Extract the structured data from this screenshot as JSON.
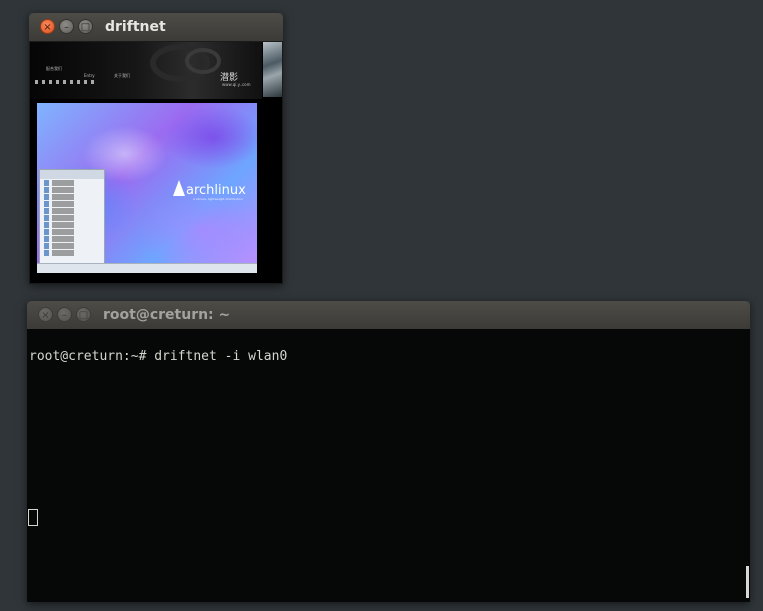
{
  "driftnet_window": {
    "title": "driftnet",
    "captured_image": {
      "logo_text": "潜影",
      "logo_sub": "www.qi.y..com",
      "tiny_text_1": "配合我们",
      "tiny_text_2": "Entry",
      "tiny_text_3": "关于我们"
    },
    "wallpaper": {
      "brand": "archlinux",
      "tagline": "A simple, lightweight distribution"
    }
  },
  "terminal_window": {
    "title": "root@creturn: ~",
    "prompt_line": "root@creturn:~# driftnet -i wlan0"
  },
  "window_buttons": {
    "close": "×",
    "minimize": "–",
    "maximize": "□"
  }
}
